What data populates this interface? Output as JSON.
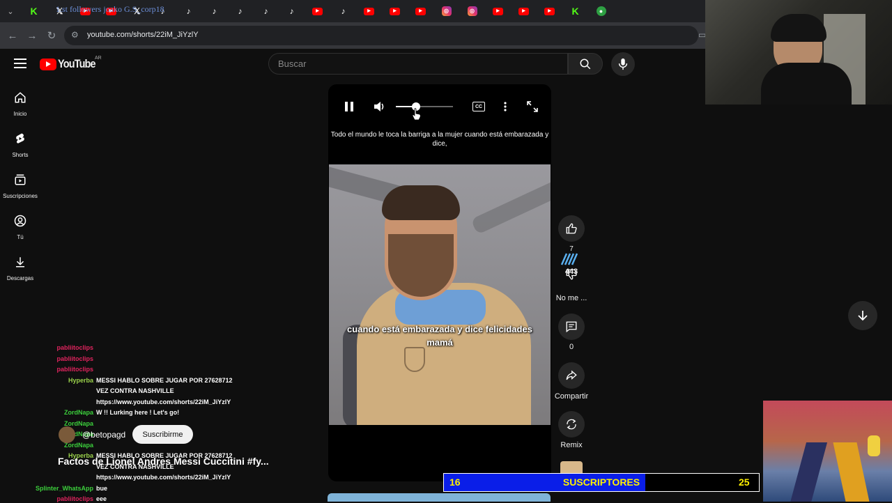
{
  "browser": {
    "active_tab_title": "1.st followers joako G.S_corp18",
    "tab_icons": [
      "k",
      "x",
      "yt",
      "yt",
      "x",
      "tt",
      "tt",
      "tt",
      "tt",
      "tt",
      "tt",
      "yt",
      "tt",
      "yt",
      "yt",
      "yt",
      "ig",
      "ig",
      "yt",
      "yt",
      "yt",
      "k",
      "gr"
    ],
    "url": "youtube.com/shorts/22iM_JiYzlY"
  },
  "header": {
    "logo_text": "YouTube",
    "country_code": "AR",
    "search_placeholder": "Buscar"
  },
  "sidebar": {
    "items": [
      {
        "label": "Inicio",
        "icon": "home-icon"
      },
      {
        "label": "Shorts",
        "icon": "shorts-icon"
      },
      {
        "label": "Suscripciones",
        "icon": "subscriptions-icon"
      },
      {
        "label": "Tú",
        "icon": "account-icon"
      },
      {
        "label": "Descargas",
        "icon": "download-icon"
      }
    ]
  },
  "player": {
    "caption_top": "Todo el mundo le toca la barriga a la mujer cuando está embarazada y dice,",
    "caption_video": "cuando está embarazada y dice felicidades mamá",
    "volume_level": 0.35,
    "cc_label": "CC"
  },
  "actions": {
    "like_count": "7",
    "like_overlay": "443",
    "dislike_label": "No me ...",
    "comment_count": "0",
    "share_label": "Compartir",
    "remix_label": "Remix"
  },
  "channel": {
    "name": "@betopagd",
    "subscribe_label": "Suscribirme"
  },
  "video_title": "Factos de Lionel Andres Messi Cuccitini #fy...",
  "chat": [
    {
      "user": "pabliitoclips",
      "msg": "",
      "color": "#e0245e"
    },
    {
      "user": "pabliitoclips",
      "msg": "",
      "color": "#e0245e"
    },
    {
      "user": "pabliitoclips",
      "msg": "",
      "color": "#e0245e"
    },
    {
      "user": "Hyperba",
      "msg": "MESSI HABLO SOBRE JUGAR POR 27628712",
      "color": "#9ad14b"
    },
    {
      "user": "",
      "msg": "VEZ CONTRA NASHVILLE",
      "color": "#9ad14b"
    },
    {
      "user": "",
      "msg": "https://www.youtube.com/shorts/22iM_JiYzlY",
      "color": "#9ad14b"
    },
    {
      "user": "ZordNapa",
      "msg": "W !! Lurking here ! Let's go!",
      "color": "#3ccf3c"
    },
    {
      "user": "ZordNapa",
      "msg": "",
      "color": "#3ccf3c"
    },
    {
      "user": "ZordNapa",
      "msg": "",
      "color": "#3ccf3c"
    },
    {
      "user": "ZordNapa",
      "msg": "",
      "color": "#3ccf3c"
    },
    {
      "user": "Hyperba",
      "msg": "MESSI HABLO SOBRE JUGAR POR 27628712",
      "color": "#9ad14b"
    },
    {
      "user": "",
      "msg": "VEZ CONTRA NASHVILLE",
      "color": "#9ad14b"
    },
    {
      "user": "",
      "msg": "https://www.youtube.com/shorts/22iM_JiYzlY",
      "color": "#9ad14b"
    },
    {
      "user": "Splinter_WhatsApp",
      "msg": "bue",
      "color": "#3ccf3c"
    },
    {
      "user": "pabliitoclips",
      "msg": "eee",
      "color": "#e0245e"
    }
  ],
  "sub_goal": {
    "current": "16",
    "label": "SUSCRIPTORES",
    "goal": "25",
    "progress": 0.64
  }
}
